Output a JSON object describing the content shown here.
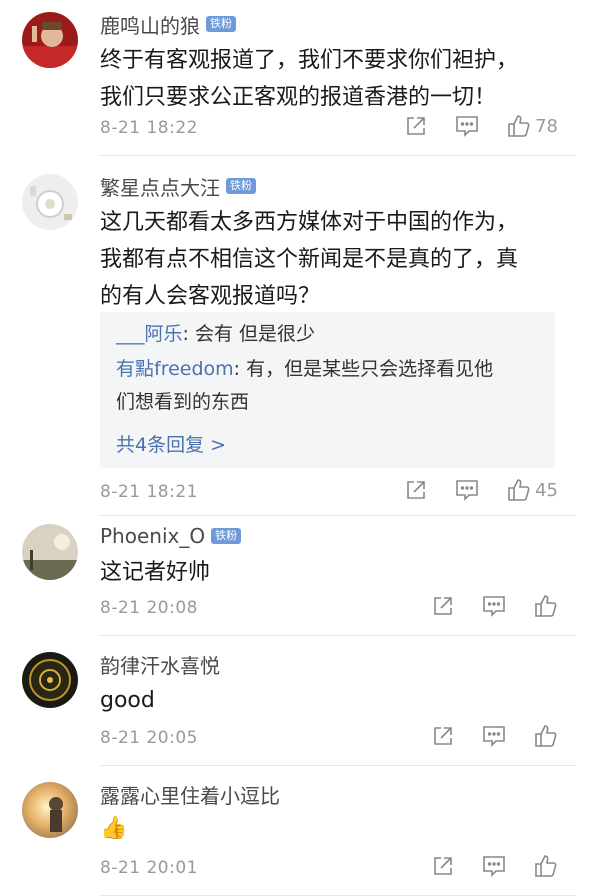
{
  "comments": [
    {
      "username": "鹿鸣山的狼",
      "badge": "铁粉",
      "text_lines": [
        "终于有客观报道了，我们不要求你们袒护，",
        "我们只要求公正客观的报道香港的一切！"
      ],
      "time": "8-21 18:22",
      "likes": "78"
    },
    {
      "username": "繁星点点大汪",
      "badge": "铁粉",
      "text_lines": [
        "这几天都看太多西方媒体对于中国的作为，",
        "我都有点不相信这个新闻是不是真的了，真",
        "的有人会客观报道吗？"
      ],
      "replies": [
        {
          "name": "___阿乐",
          "text": ": 会有   但是很少"
        },
        {
          "name": "有點freedom",
          "text": ": 有，但是某些只会选择看见他"
        }
      ],
      "reply_continuation": "们想看到的东西",
      "more_replies": "共4条回复 >",
      "time": "8-21 18:21",
      "likes": "45"
    },
    {
      "username": "Phoenix_O",
      "badge": "铁粉",
      "text_lines": [
        "这记者好帅"
      ],
      "time": "8-21 20:08",
      "likes": ""
    },
    {
      "username": "韵律汗水喜悦",
      "text_lines": [
        "good"
      ],
      "time": "8-21 20:05",
      "likes": ""
    },
    {
      "username": "露露心里住着小逗比",
      "text_lines": [
        "👍"
      ],
      "time": "8-21 20:01",
      "likes": ""
    }
  ],
  "icons": {
    "share": "share-icon",
    "reply": "comment-icon",
    "like": "thumbs-up-icon"
  },
  "colors": {
    "badge": "#6e9ad9",
    "link": "#4b72b0",
    "meta": "#999999",
    "reply_bg": "#f4f5f7"
  }
}
